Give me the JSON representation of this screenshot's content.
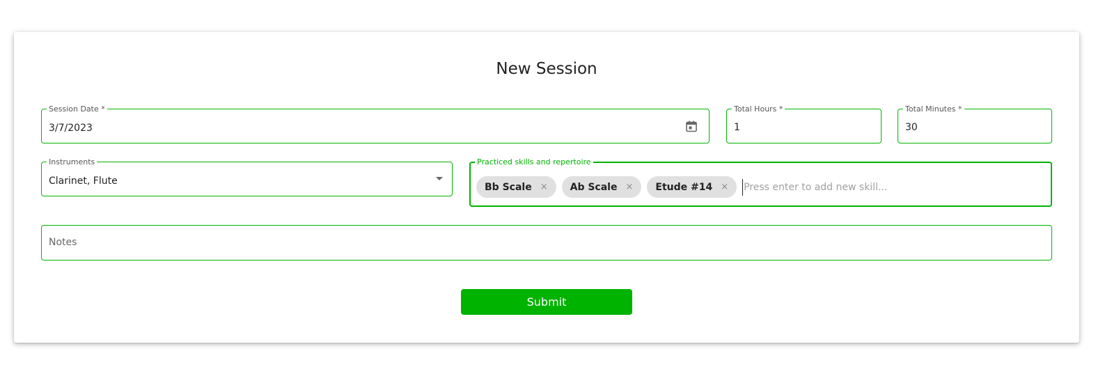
{
  "form": {
    "title": "New Session",
    "session_date": {
      "label": "Session Date *",
      "value": "3/7/2023"
    },
    "total_hours": {
      "label": "Total Hours *",
      "value": "1"
    },
    "total_minutes": {
      "label": "Total Minutes *",
      "value": "30"
    },
    "instruments": {
      "label": "Instruments",
      "value": "Clarinet, Flute"
    },
    "skills": {
      "label": "Practiced skills and repertoire",
      "chips": [
        {
          "label": "Bb Scale",
          "remove": "×"
        },
        {
          "label": "Ab Scale",
          "remove": "×"
        },
        {
          "label": "Etude #14",
          "remove": "×"
        }
      ],
      "placeholder": "Press enter to add new skill..."
    },
    "notes": {
      "placeholder": "Notes"
    },
    "submit_label": "Submit"
  },
  "icons": {
    "calendar": "calendar-icon",
    "dropdown": "chevron-down-icon",
    "chip_remove": "close-icon"
  },
  "colors": {
    "accent": "#00b300",
    "chip_bg": "#e0e0e0",
    "button_text": "#ffffff"
  }
}
